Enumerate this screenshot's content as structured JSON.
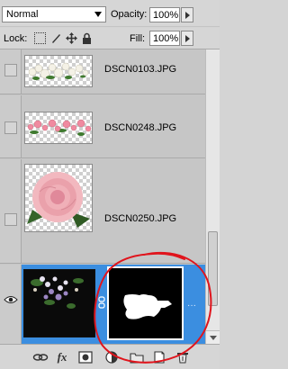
{
  "blend": {
    "mode": "Normal"
  },
  "opacity": {
    "label": "Opacity:",
    "value": "100%"
  },
  "lock": {
    "label": "Lock:"
  },
  "fill": {
    "label": "Fill:",
    "value": "100%"
  },
  "layers": [
    {
      "name": "DSCN0103.JPG",
      "visible": false
    },
    {
      "name": "DSCN0248.JPG",
      "visible": false
    },
    {
      "name": "DSCN0250.JPG",
      "visible": false
    },
    {
      "name": "",
      "visible": true,
      "selected": true,
      "has_mask": true
    }
  ],
  "toolbar": {
    "fx_label": "fx",
    "icons": [
      "link-layers-icon",
      "fx-icon",
      "add-mask-icon",
      "adjustment-layer-icon",
      "group-folder-icon",
      "new-layer-icon",
      "trash-icon"
    ]
  },
  "colors": {
    "selected_row": "#3b8ee0",
    "annotation": "#e0141c"
  }
}
